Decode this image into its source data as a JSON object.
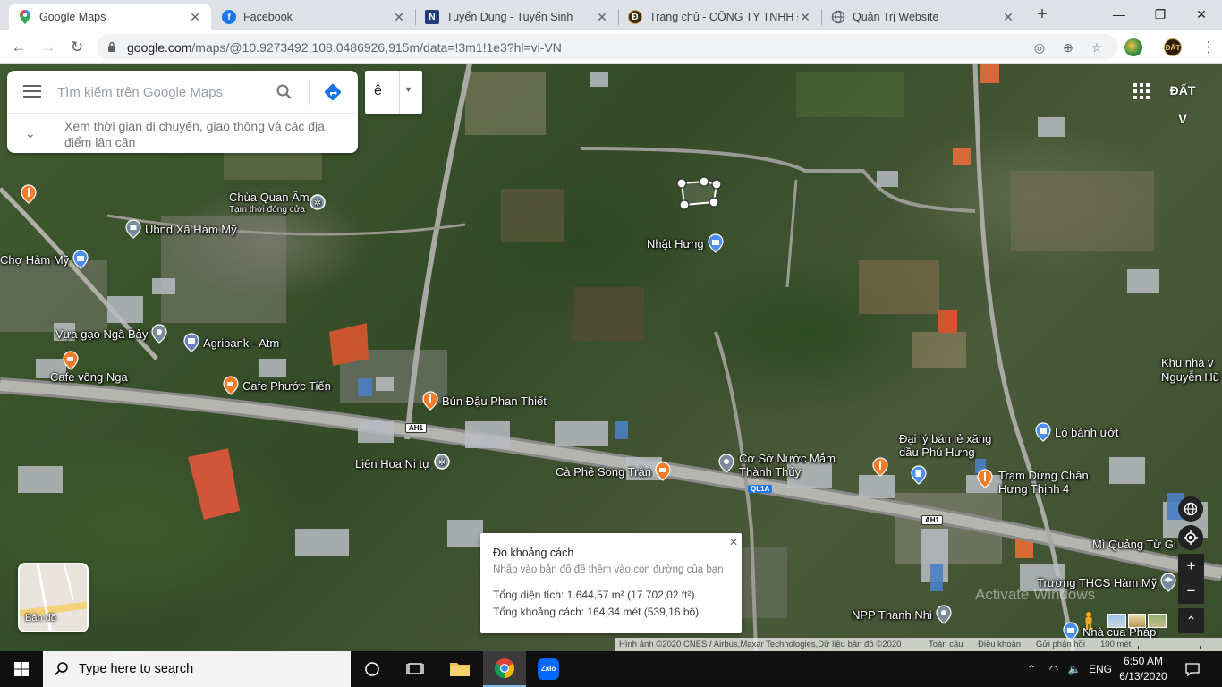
{
  "browser": {
    "tabs": [
      {
        "title": "Google Maps",
        "active": true,
        "favicon": "maps-pin-icon"
      },
      {
        "title": "Facebook",
        "active": false,
        "favicon": "facebook-icon"
      },
      {
        "title": "Tuyển Dung - Tuyển Sinh",
        "active": false,
        "favicon": "tn-logo-icon"
      },
      {
        "title": "Trang chủ - CÔNG TY TNHH Đ",
        "active": false,
        "favicon": "company-logo-icon"
      },
      {
        "title": "Quản Trị Website",
        "active": false,
        "favicon": "globe-icon"
      }
    ],
    "url_host": "google.com",
    "url_path": "/maps/@10.9273492,108.0486926,915m/data=!3m1!1e3?hl=vi-VN"
  },
  "maps": {
    "search_placeholder": "Tìm kiếm trên Google Maps",
    "explore_text": "Xem thời gian di chuyển, giao thông và các địa điểm lân cận",
    "ime_key": "ê",
    "account_badge": "ĐẤT V",
    "layer_label": "Bản đồ",
    "pois": [
      {
        "name": "Chùa Quan Âm",
        "sub": "Tạm thời đóng cửa"
      },
      {
        "name": "Ubnd Xã Hàm Mỹ"
      },
      {
        "name": "Chợ Hàm Mỹ"
      },
      {
        "name": "Nhật Hưng"
      },
      {
        "name": "Vựa gạo Ngã Bảy"
      },
      {
        "name": "Agribank - Atm"
      },
      {
        "name": "Cafe võng Nga"
      },
      {
        "name": "Cafe Phước Tiến"
      },
      {
        "name": "Bún Đậu Phan Thiết"
      },
      {
        "name": "Liên Hoa Ni tự"
      },
      {
        "name": "Cà Phê Song Trân"
      },
      {
        "name": "Cơ Sở Nước Mắm Thành Thủy"
      },
      {
        "name": "Đại lý bán lẻ xăng dầu Phú Hưng"
      },
      {
        "name": "Trạm Dừng Chân Hưng Thịnh 4"
      },
      {
        "name": "Lò bánh ướt"
      },
      {
        "name": "Khu nhà v Nguyễn Hũ"
      },
      {
        "name": "Mì Quảng Từ Gi"
      },
      {
        "name": "Trường THCS Hàm Mỹ"
      },
      {
        "name": "NPP Thanh Nhi"
      },
      {
        "name": "Nhà của Pháp"
      }
    ],
    "road_labels": {
      "ah1_a": "AH1",
      "ah1_b": "AH1",
      "ql1a": "QL1A"
    },
    "measure": {
      "title": "Đo khoảng cách",
      "hint": "Nhấp vào bản đồ để thêm vào con đường của bạn",
      "area": "Tổng diện tích: 1.644,57 m² (17.702,02 ft²)",
      "distance": "Tổng khoảng cách: 164,34 mét (539,16 bộ)"
    },
    "watermark": "Activate Windows",
    "attribution": {
      "imagery": "Hình ảnh ©2020 CNES / Airbus,Maxar Technologies,Dữ liệu bản đồ ©2020",
      "global": "Toàn cầu",
      "terms": "Điều khoản",
      "feedback": "Gửi phản hồi",
      "scale": "100 mét"
    }
  },
  "taskbar": {
    "search_placeholder": "Type here to search",
    "lang": "ENG",
    "time": "6:50 AM",
    "date": "6/13/2020",
    "zalo_label": "Zalo"
  },
  "colors": {
    "accent_blue": "#4285f4",
    "poi_orange": "#f57c28",
    "poi_blue": "#4b8ff0"
  }
}
